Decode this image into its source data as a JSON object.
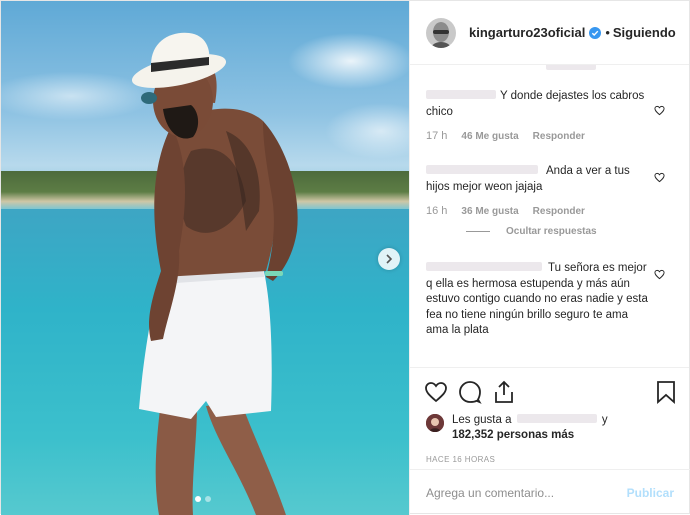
{
  "post": {
    "username": "kingarturo23oficial",
    "separator": "•",
    "follow_status": "Siguiendo",
    "carousel_index": 1,
    "carousel_count": 2
  },
  "comments": [
    {
      "text": "Y donde dejastes los cabros chico",
      "time": "17 h",
      "likes": "46 Me gusta",
      "reply": "Responder"
    },
    {
      "text": "Anda a ver a tus hijos mejor weon jajaja",
      "time": "16 h",
      "likes": "36 Me gusta",
      "reply": "Responder",
      "hide_replies": "Ocultar respuestas"
    },
    {
      "text_suffix": "Tu señora es mejor q ella es hermosa estupenda y más aún estuvo contigo cuando no eras nadie y esta fea no tiene ningún brillo seguro te ama ama la plata"
    }
  ],
  "likes": {
    "prefix": "Les gusta a",
    "joiner": "y",
    "count_text": "182,352 personas más"
  },
  "timestamp": "HACE 16 HORAS",
  "composer": {
    "placeholder": "Agrega un comentario...",
    "publish_label": "Publicar"
  },
  "colors": {
    "accent_disabled": "#b2dffc",
    "verified": "#3897f0",
    "muted": "#999999"
  },
  "icons": [
    "verified-badge-icon",
    "heart-icon",
    "comment-icon",
    "share-icon",
    "bookmark-icon",
    "chevron-right-icon"
  ]
}
